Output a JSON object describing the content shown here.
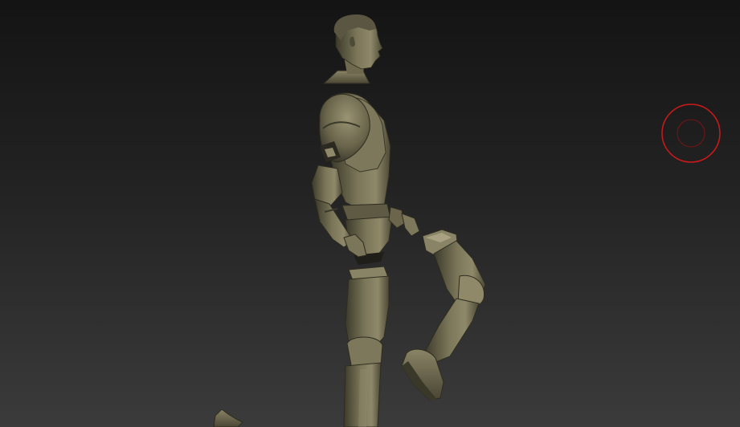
{
  "viewport": {
    "background_top": "#141414",
    "background_bottom": "#3b3b3b"
  },
  "model": {
    "parts": [
      "head-bust",
      "torso-armor",
      "right-arm",
      "left-hand",
      "left-leg",
      "right-leg",
      "foot-fragment"
    ],
    "material_base": "#6f6a4f",
    "material_shadow": "#2e2c20",
    "material_highlight": "#a9a282"
  },
  "brush_cursor": {
    "icon": "brush-cursor-icon",
    "color": "#cc1a1a"
  }
}
